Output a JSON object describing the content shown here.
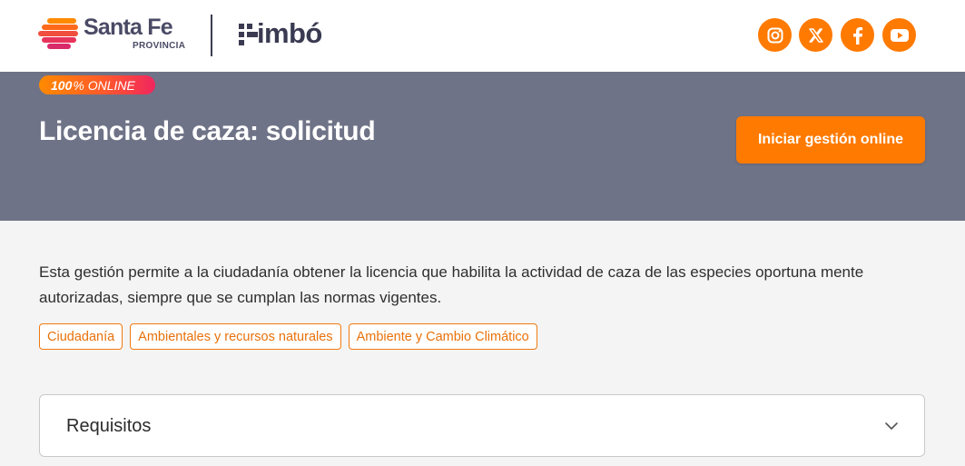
{
  "header": {
    "brand_name": "Santa Fe",
    "brand_sub": "PROVINCIA",
    "product_name": "imbó",
    "social": [
      {
        "name": "instagram-icon"
      },
      {
        "name": "x-icon"
      },
      {
        "name": "facebook-icon"
      },
      {
        "name": "youtube-icon"
      }
    ]
  },
  "hero": {
    "badge_bold": "100",
    "badge_rest": "% ONLINE",
    "title": "Licencia de caza: solicitud",
    "cta_label": "Iniciar gestión online"
  },
  "main": {
    "description": "Esta gestión permite a la ciudadanía obtener la licencia que habilita la actividad de caza de las especies oportuna mente autorizadas, siempre que se cumplan las normas vigentes.",
    "tags": [
      "Ciudadanía",
      "Ambientales y recursos naturales",
      "Ambiente y Cambio Climático"
    ],
    "accordion": {
      "title": "Requisitos",
      "expanded": false
    }
  },
  "colors": {
    "accent": "#ff7a00",
    "hero_bg": "#6f7387",
    "page_bg": "#f4f4f4",
    "brand_dark": "#3a3a52"
  }
}
